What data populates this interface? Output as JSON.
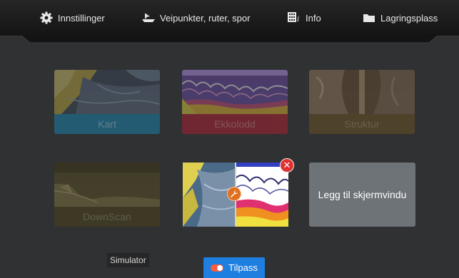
{
  "toolbar": {
    "items": [
      {
        "label": "Innstillinger",
        "icon": "gear-icon"
      },
      {
        "label": "Veipunkter, ruter, spor",
        "icon": "boat-icon"
      },
      {
        "label": "Info",
        "icon": "info-icon"
      },
      {
        "label": "Lagringsplass",
        "icon": "folder-icon"
      }
    ]
  },
  "tiles": [
    {
      "label": "Kart",
      "label_bg": "#1a7fa6",
      "label_color": "#8fbfd3"
    },
    {
      "label": "Ekkolodd",
      "label_bg": "#a82030",
      "label_color": "#c97079"
    },
    {
      "label": "Struktur",
      "label_bg": "#6a5024",
      "label_color": "#9a8660"
    },
    {
      "label": "DownScan",
      "label_bg": "#4a4018",
      "label_color": "#8a8262"
    }
  ],
  "custom_tile": {
    "close_icon": "close-icon",
    "edit_icon": "wrench-icon"
  },
  "add_tile": {
    "label": "Legg til skjermvindu"
  },
  "footer": {
    "simulator_label": "Simulator",
    "customize_label": "Tilpass",
    "accent": "#1e7fe0"
  }
}
